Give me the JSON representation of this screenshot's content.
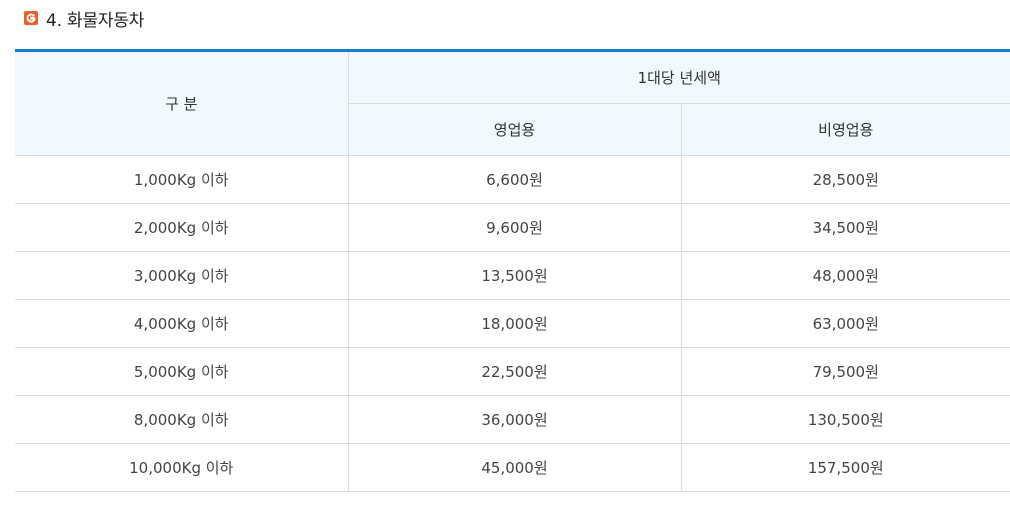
{
  "section": {
    "icon": "g-badge-icon",
    "accent_color": "#e8612c",
    "title": "4. 화물자동차"
  },
  "table": {
    "header_color": "#1a7cc1",
    "header_bg": "#f0f9fe",
    "category_label": "구 분",
    "group_label": "1대당 년세액",
    "sub_headers": [
      "영업용",
      "비영업용"
    ],
    "rows": [
      {
        "category": "1,000Kg 이하",
        "business": "6,600원",
        "non_business": "28,500원"
      },
      {
        "category": "2,000Kg 이하",
        "business": "9,600원",
        "non_business": "34,500원"
      },
      {
        "category": "3,000Kg 이하",
        "business": "13,500원",
        "non_business": "48,000원"
      },
      {
        "category": "4,000Kg 이하",
        "business": "18,000원",
        "non_business": "63,000원"
      },
      {
        "category": "5,000Kg 이하",
        "business": "22,500원",
        "non_business": "79,500원"
      },
      {
        "category": "8,000Kg 이하",
        "business": "36,000원",
        "non_business": "130,500원"
      },
      {
        "category": "10,000Kg 이하",
        "business": "45,000원",
        "non_business": "157,500원"
      }
    ]
  }
}
